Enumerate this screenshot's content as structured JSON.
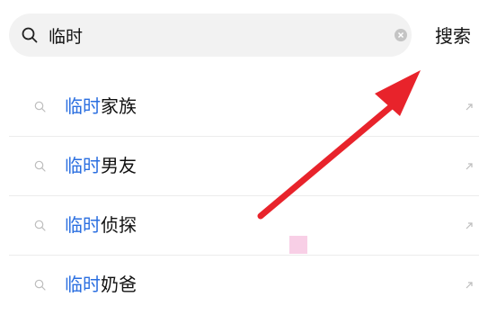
{
  "search": {
    "value": "临时",
    "button_label": "搜索"
  },
  "suggestions": [
    {
      "highlight": "临时",
      "rest": "家族"
    },
    {
      "highlight": "临时",
      "rest": "男友"
    },
    {
      "highlight": "临时",
      "rest": "侦探"
    },
    {
      "highlight": "临时",
      "rest": "奶爸"
    }
  ],
  "colors": {
    "highlight": "#2b6fe0",
    "annotation_arrow": "#e8232b"
  },
  "icons": {
    "search": "search-icon",
    "clear": "clear-icon",
    "suggestion": "search-icon",
    "fill": "arrow-up-left-icon"
  }
}
